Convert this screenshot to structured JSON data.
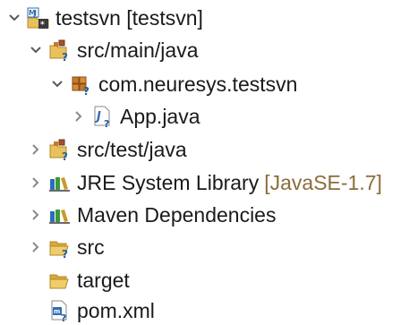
{
  "tree": {
    "project": {
      "label": "testsvn [testsvn]",
      "expanded": true
    },
    "src_main_java": {
      "label": "src/main/java",
      "expanded": true
    },
    "package": {
      "label": "com.neuresys.testsvn",
      "expanded": true
    },
    "app_java": {
      "label": "App.java",
      "expanded": false
    },
    "src_test_java": {
      "label": "src/test/java",
      "expanded": false
    },
    "jre_library": {
      "label": "JRE System Library",
      "decoration": "[JavaSE-1.7]",
      "expanded": false
    },
    "maven_deps": {
      "label": "Maven Dependencies",
      "expanded": false
    },
    "src_folder": {
      "label": "src",
      "expanded": false
    },
    "target_folder": {
      "label": "target"
    },
    "pom_xml": {
      "label": "pom.xml"
    }
  },
  "colors": {
    "twisty": "#595959",
    "folder": "#e8c15a",
    "folder_stroke": "#b08a2a",
    "java_blue": "#2f6db5",
    "svn_question": "#1f5fa8",
    "decoration": "#8a6d3b"
  },
  "icons": {
    "project": "maven-java-project-icon",
    "source_folder": "java-source-folder-icon",
    "package": "java-package-icon",
    "java_file": "java-file-icon",
    "library": "library-icon",
    "folder": "folder-icon",
    "xml_file": "xml-file-icon"
  }
}
